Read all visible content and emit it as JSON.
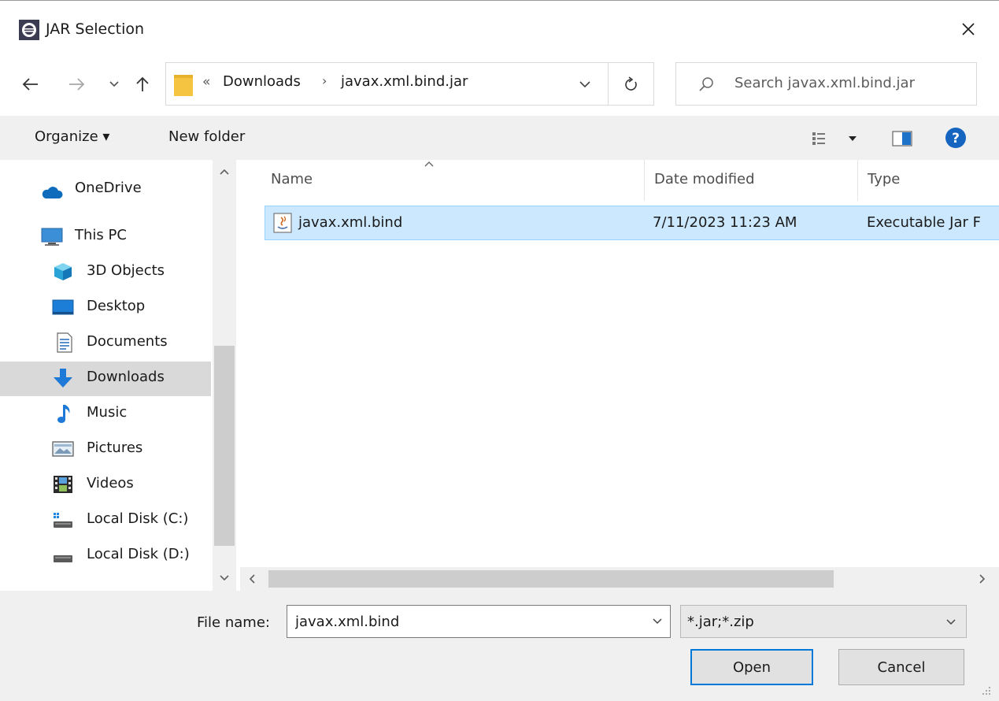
{
  "window": {
    "title": "JAR Selection",
    "app_icon": "eclipse-icon"
  },
  "navigation": {
    "back_icon": "arrow-left-icon",
    "forward_icon": "arrow-right-icon",
    "recent_icon": "chevron-down-icon",
    "up_icon": "arrow-up-icon"
  },
  "address": {
    "overflow": "«",
    "crumbs": [
      "Downloads",
      "javax.xml.bind.jar"
    ],
    "separator": "›"
  },
  "search": {
    "placeholder": "Search javax.xml.bind.jar"
  },
  "toolbar": {
    "organize_label": "Organize ▾",
    "new_folder_label": "New folder"
  },
  "sidebar": {
    "items": [
      {
        "label": "OneDrive",
        "icon": "cloud-icon"
      },
      {
        "label": "This PC",
        "icon": "computer-icon"
      },
      {
        "label": "3D Objects",
        "icon": "cube-icon"
      },
      {
        "label": "Desktop",
        "icon": "desktop-icon"
      },
      {
        "label": "Documents",
        "icon": "document-icon"
      },
      {
        "label": "Downloads",
        "icon": "download-icon",
        "selected": true
      },
      {
        "label": "Music",
        "icon": "music-note-icon"
      },
      {
        "label": "Pictures",
        "icon": "picture-icon"
      },
      {
        "label": "Videos",
        "icon": "film-icon"
      },
      {
        "label": "Local Disk (C:)",
        "icon": "drive-icon"
      },
      {
        "label": "Local Disk (D:)",
        "icon": "drive-icon"
      }
    ]
  },
  "filelist": {
    "columns": [
      "Name",
      "Date modified",
      "Type"
    ],
    "rows": [
      {
        "name": "javax.xml.bind",
        "date": "7/11/2023 11:23 AM",
        "type": "Executable Jar F"
      }
    ]
  },
  "footer": {
    "file_name_label": "File name:",
    "file_name_value": "javax.xml.bind",
    "file_type_value": "*.jar;*.zip",
    "open_label": "Open",
    "cancel_label": "Cancel"
  },
  "colors": {
    "selection": "#cce8ff",
    "accent": "#0078d7",
    "help": "#1565c0"
  }
}
